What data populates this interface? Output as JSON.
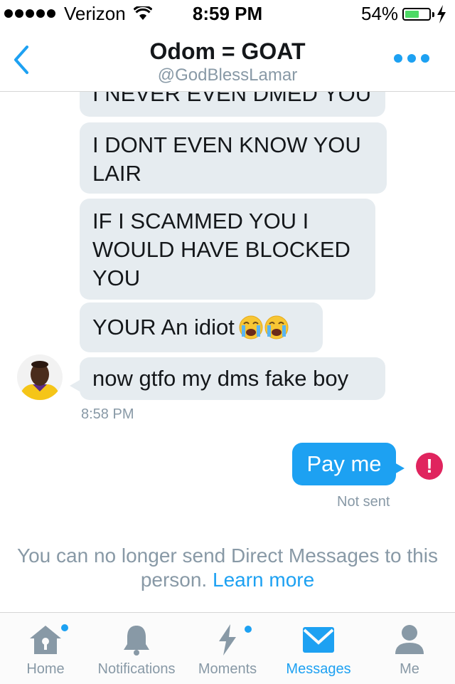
{
  "status_bar": {
    "carrier": "Verizon",
    "time": "8:59 PM",
    "battery_percent": "54%",
    "battery_level": 0.54,
    "signal_bars": 5
  },
  "nav": {
    "title": "Odom = GOAT",
    "subtitle": "@GodBlessLamar",
    "back_icon": "chevron-left-icon",
    "more_icon": "more-dots-icon",
    "accent": "#1da1f2"
  },
  "messages": {
    "incoming": [
      {
        "text": "I NEVER EVEN DMED YOU"
      },
      {
        "text": "I DONT EVEN KNOW YOU\nLAIR"
      },
      {
        "text": "IF I SCAMMED YOU I\nWOULD HAVE BLOCKED\nYOU"
      },
      {
        "text": "YOUR An idiot"
      },
      {
        "text": "now gtfo my dms fake boy"
      }
    ],
    "incoming_timestamp": "8:58 PM",
    "outgoing": [
      {
        "text": "Pay me",
        "status": "Not sent"
      }
    ]
  },
  "notice": {
    "text": "You can no longer send Direct Messages to this person.",
    "link": "Learn more"
  },
  "tabs": [
    {
      "label": "Home",
      "icon": "home-icon",
      "badge": true,
      "active": false
    },
    {
      "label": "Notifications",
      "icon": "bell-icon",
      "badge": false,
      "active": false
    },
    {
      "label": "Moments",
      "icon": "lightning-icon",
      "badge": true,
      "active": false
    },
    {
      "label": "Messages",
      "icon": "envelope-icon",
      "badge": false,
      "active": true
    },
    {
      "label": "Me",
      "icon": "person-icon",
      "badge": false,
      "active": false
    }
  ],
  "colors": {
    "accent": "#1da1f2",
    "bubble_incoming": "#e6ecf0",
    "error": "#e0245e",
    "muted": "#8899a6"
  }
}
